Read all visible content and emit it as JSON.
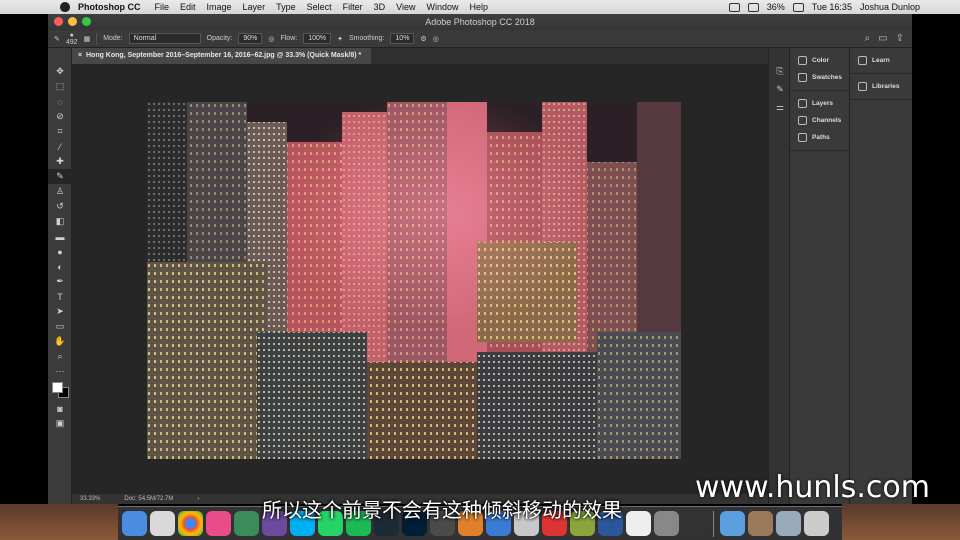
{
  "menubar": {
    "app_name": "Photoshop CC",
    "items": [
      "File",
      "Edit",
      "Image",
      "Layer",
      "Type",
      "Select",
      "Filter",
      "3D",
      "View",
      "Window",
      "Help"
    ],
    "battery": "36%",
    "clock": "Tue 16:35",
    "user": "Joshua Dunlop"
  },
  "window": {
    "title": "Adobe Photoshop CC 2018"
  },
  "options": {
    "brush_size": "492",
    "mode_label": "Mode:",
    "mode_value": "Normal",
    "opacity_label": "Opacity:",
    "opacity_value": "90%",
    "flow_label": "Flow:",
    "flow_value": "100%",
    "smoothing_label": "Smoothing:",
    "smoothing_value": "10%"
  },
  "document": {
    "tab_title": "Hong Kong, September 2016–September 16, 2016–62.jpg @ 33.3% (Quick Mask/8) *"
  },
  "status": {
    "zoom": "33.33%",
    "doc": "Doc: 54.5M/72.7M"
  },
  "panels": {
    "group1": [
      "Color",
      "Swatches"
    ],
    "group2": [
      "Layers",
      "Channels",
      "Paths"
    ],
    "group3": [
      "Learn",
      "Libraries"
    ]
  },
  "subtitle": "所以这个前景不会有这种倾斜移动的效果",
  "watermark": "www.hunls.com",
  "colors": {
    "accent": "#ff5a6e",
    "ui_dark": "#3a3a3a",
    "canvas_bg": "#262626"
  }
}
